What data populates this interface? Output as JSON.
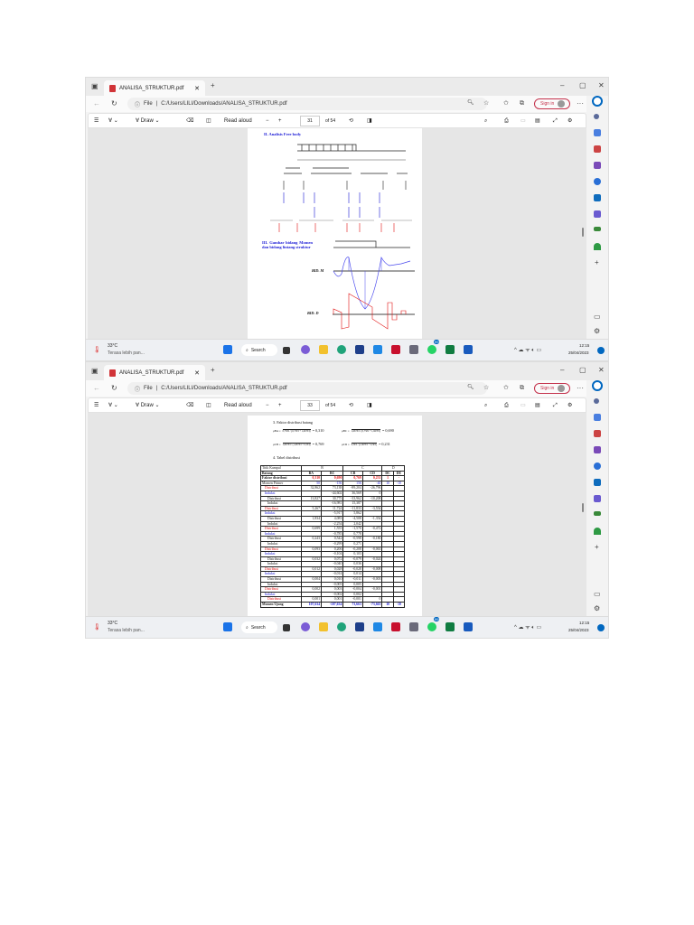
{
  "browser": {
    "tab_title": "ANALISA_STRUKTUR.pdf",
    "file_label": "File",
    "url": "C:/Users/LILI/Downloads/ANALISA_STRUKTUR.pdf",
    "sign_in": "Sign in",
    "draw_label": "Draw",
    "read_aloud": "Read aloud",
    "page_total": "of 54"
  },
  "taskbar": {
    "weather_temp": "33°C",
    "weather_desc": "Terasa lebih pan...",
    "search_label": "Search",
    "time": "12:15",
    "date": "25/04/2023",
    "whatsapp_badge": "99"
  },
  "windows": [
    {
      "page_number": "31"
    },
    {
      "page_number": "33"
    }
  ],
  "page31": {
    "section2_title": "II. Analisis Free body",
    "section3_title": "III. Gambar bidang Momen dan bidang lintang struktur",
    "bid_m": "BID. M",
    "bid_d": "BID. D"
  },
  "page33": {
    "section3_title": "3. Faktor distribusi batang",
    "formulas": [
      {
        "label": "μBA =",
        "expr": "0,75EI / (0,75EI + 1,667EI)",
        "value": "= 0,310"
      },
      {
        "label": "μBC =",
        "expr": "1,667EI / (0,75EI + 1,667EI)",
        "value": "= 0,690"
      },
      {
        "label": "μCB =",
        "expr": "1,667EI / (1,667EI + 0,5EI)",
        "value": "= 0,769"
      },
      {
        "label": "μCD =",
        "expr": "0,5EI / (1,667EI + 0,5EI)",
        "value": "= 0,231"
      }
    ],
    "section4_title": "4. Tabel distribusi",
    "table": {
      "joint_label": "Titik Kumpul",
      "joints": [
        "B",
        "C",
        "D"
      ],
      "member_label": "Batang",
      "members": [
        "BA",
        "BC",
        "CB",
        "CD",
        "DC",
        "DE"
      ],
      "df_label": "Faktor distribusi",
      "df": [
        "0,310",
        "0,690",
        "0,769",
        "0,231",
        "1",
        "-"
      ],
      "fem_label": "Momen Primer",
      "fem": [
        "50",
        "-156",
        "156",
        "-40",
        "10",
        "-10"
      ],
      "rows": [
        {
          "label": "Distribusi",
          "kind": "d",
          "v": [
            "32,862",
            "73,138",
            "-89,204",
            "-26,796",
            "",
            ""
          ]
        },
        {
          "label": "Induksi",
          "kind": "i",
          "v": [
            "",
            "-44,602",
            "36,569",
            "0",
            "",
            ""
          ]
        },
        {
          "label": "Distribusi",
          "kind": "d2",
          "v": [
            "13,827",
            "30,775",
            "-33,962",
            "-10,208",
            "",
            ""
          ]
        },
        {
          "label": "Induksi",
          "kind": "i2",
          "v": [
            "",
            "-16,981",
            "15,387",
            "",
            "",
            ""
          ]
        },
        {
          "label": "Distribusi",
          "kind": "d",
          "v": [
            "5,267",
            "11,724",
            "-11,833",
            "-3,554",
            "",
            ""
          ]
        },
        {
          "label": "Induksi",
          "kind": "i",
          "v": [
            "",
            "-5,917",
            "5,862",
            "",
            "",
            ""
          ]
        },
        {
          "label": "Distribusi",
          "kind": "d2",
          "v": [
            "1,834",
            "4,083",
            "-4,508",
            "-1,354",
            "",
            ""
          ]
        },
        {
          "label": "Induksi",
          "kind": "i2",
          "v": [
            "",
            "-2,254",
            "2,042",
            "",
            "",
            ""
          ]
        },
        {
          "label": "Distribusi",
          "kind": "d",
          "v": [
            "0,699",
            "1,555",
            "-1,570",
            "-0,472",
            "",
            ""
          ]
        },
        {
          "label": "Induksi",
          "kind": "i",
          "v": [
            "",
            "-0,785",
            "0,778",
            "",
            "",
            ""
          ]
        },
        {
          "label": "Distribusi",
          "kind": "d2",
          "v": [
            "0,243",
            "0,542",
            "-0,598",
            "-0,180",
            "",
            ""
          ]
        },
        {
          "label": "Induksi",
          "kind": "i2",
          "v": [
            "",
            "-0,299",
            "0,271",
            "",
            "",
            ""
          ]
        },
        {
          "label": "Distribusi",
          "kind": "d",
          "v": [
            "0,093",
            "0,206",
            "-0,208",
            "-0,063",
            "",
            ""
          ]
        },
        {
          "label": "Induksi",
          "kind": "i",
          "v": [
            "",
            "-0,104",
            "0,103",
            "",
            "",
            ""
          ]
        },
        {
          "label": "Distribusi",
          "kind": "d2",
          "v": [
            "0,032",
            "0,072",
            "-0,079",
            "-0,024",
            "",
            ""
          ]
        },
        {
          "label": "Induksi",
          "kind": "i2",
          "v": [
            "",
            "-0,040",
            "0,036",
            "",
            "",
            ""
          ]
        },
        {
          "label": "Distribusi",
          "kind": "d",
          "v": [
            "0,012",
            "0,028",
            "-0,028",
            "-0,008",
            "",
            ""
          ]
        },
        {
          "label": "Induksi",
          "kind": "i",
          "v": [
            "",
            "-0,014",
            "0,014",
            "",
            "",
            ""
          ]
        },
        {
          "label": "Distribusi",
          "kind": "d2",
          "v": [
            "0,004",
            "0,010",
            "-0,011",
            "-0,003",
            "",
            ""
          ]
        },
        {
          "label": "Induksi",
          "kind": "i2",
          "v": [
            "",
            "-0,005",
            "0,005",
            "",
            "",
            ""
          ]
        },
        {
          "label": "Distribusi",
          "kind": "d",
          "v": [
            "0,002",
            "0,003",
            "-0,004",
            "-0,001",
            "",
            ""
          ]
        },
        {
          "label": "Induksi",
          "kind": "i",
          "v": [
            "",
            "-0,002",
            "0,002",
            "",
            "",
            ""
          ]
        },
        {
          "label": "Distribusi",
          "kind": "d3",
          "v": [
            "0,001",
            "0,001",
            "-0,001",
            "0",
            "",
            ""
          ]
        }
      ],
      "end_label": "Momen Ujung",
      "end": [
        "107,634",
        "-107,634",
        "73,663",
        "-73,663",
        "10",
        "-10"
      ]
    }
  },
  "colors": {
    "red": "#e01010",
    "blue": "#1a1ad6",
    "edge_accent": "#0067c0"
  }
}
